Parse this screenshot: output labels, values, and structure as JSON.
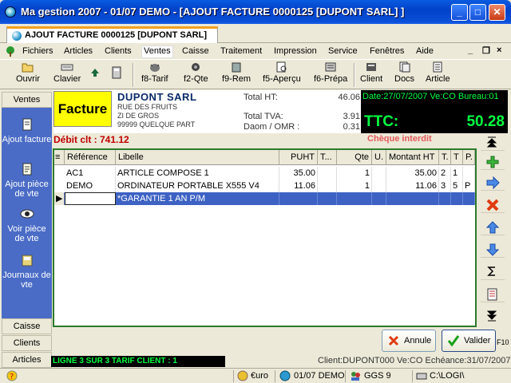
{
  "window": {
    "title": "Ma gestion 2007 - 01/07 DEMO - [AJOUT FACTURE 0000125 [DUPONT SARL] ]"
  },
  "doc_tab": {
    "label": "AJOUT FACTURE 0000125 [DUPONT SARL]"
  },
  "menu": {
    "items": [
      "Fichiers",
      "Articles",
      "Clients",
      "Ventes",
      "Caisse",
      "Traitement",
      "Impression",
      "Service",
      "Fenêtres",
      "Aide"
    ],
    "selected": "Ventes",
    "mdi_controls": [
      "_",
      "❐",
      "×"
    ]
  },
  "toolbar": {
    "open": "Ouvrir",
    "keyboard": "Clavier",
    "f8": "f8-Tarif",
    "f2": "f2-Qte",
    "f9": "f9-Rem",
    "f5": "f5-Aperçu",
    "f6": "f6-Prépa",
    "client": "Client",
    "docs": "Docs",
    "article": "Article"
  },
  "sidebar": {
    "top_tab": "Ventes",
    "items": [
      {
        "label": "Ajout facture"
      },
      {
        "label": "Ajout pièce de vte"
      },
      {
        "label": "Voir pièce de vte"
      },
      {
        "label": "Journaux de vte"
      }
    ],
    "bottom_tabs": [
      "Caisse",
      "Clients",
      "Articles"
    ]
  },
  "invoice": {
    "badge": "Facture",
    "customer_name": "DUPONT SARL",
    "address": [
      "RUE DES FRUITS",
      "ZI DE GROS",
      "99999 QUELQUE PART"
    ],
    "total_ht_label": "Total HT:",
    "total_ht": "46.06",
    "total_tva_label": "Total TVA:",
    "total_tva": "3.91",
    "daom_label": "Daom / OMR :",
    "daom": "0.31",
    "date_line": "Date:27/07/2007    Ve:CO Bureau:01",
    "ttc_label": "TTC:",
    "ttc": "50.28",
    "debit": "Débit clt : 741.12",
    "warning": "Chèque interdit"
  },
  "grid": {
    "columns": [
      "Référence",
      "Libelle",
      "PUHT",
      "T...",
      "Qte",
      "U.",
      "Montant HT",
      "T.",
      "T",
      "P."
    ],
    "rows": [
      {
        "ref": "AC1",
        "lib": "ARTICLE COMPOSE 1",
        "puht": "35.00",
        "t": "",
        "qte": "1",
        "u": "",
        "mht": "35.00",
        "t2": "2",
        "t3": "1",
        "p": ""
      },
      {
        "ref": "DEMO",
        "lib": "ORDINATEUR PORTABLE X555 V4",
        "puht": "11.06",
        "t": "",
        "qte": "1",
        "u": "",
        "mht": "11.06",
        "t2": "3",
        "t3": "5",
        "p": "P"
      },
      {
        "ref": "",
        "lib": "*GARANTIE 1 AN P/M",
        "puht": "",
        "t": "",
        "qte": "",
        "u": "",
        "mht": "",
        "t2": "",
        "t3": "",
        "p": ""
      }
    ],
    "selected_row": 2
  },
  "buttons": {
    "cancel": "Annule",
    "validate": "Valider",
    "f10": "F10"
  },
  "status": {
    "line_info": "LIGNE 3 SUR  3   TARIF CLIENT : 1",
    "client_info": "Client:DUPONT000 Ve:CO Echéance:31/07/2007",
    "currency": "€uro",
    "period": "01/07 DEMO",
    "ggs": "GGS 9",
    "path": "C:\\LOGI\\"
  },
  "colors": {
    "title_blue": "#0042c8",
    "sidebar_blue": "#4a6cc6",
    "ttc_green": "#00ff40",
    "grid_border": "#2c7a2c",
    "selection": "#3d62c4",
    "warning_red": "#e25a5a"
  }
}
